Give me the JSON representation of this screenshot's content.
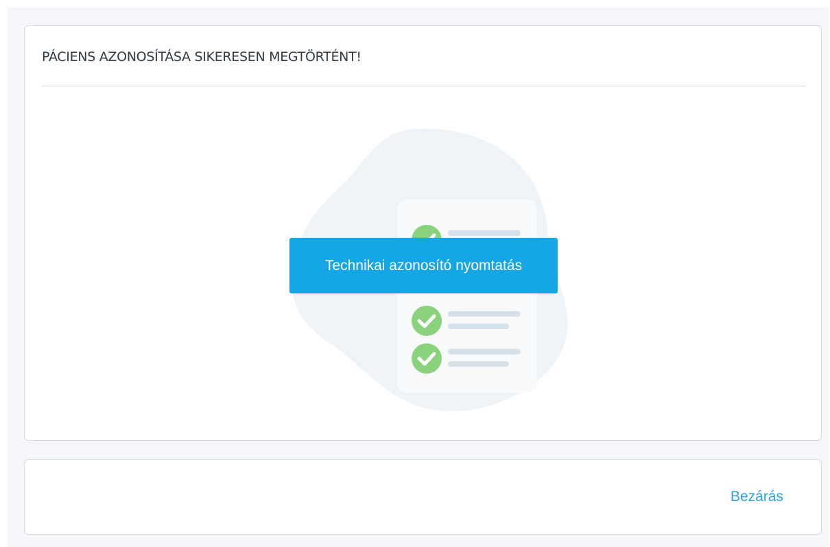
{
  "dialog": {
    "title": "PÁCIENS AZONOSÍTÁSA SIKERESEN MEGTÖRTÉNT!",
    "print_button_label": "Technikai azonosító nyomtatás",
    "illustration_icon": "checklist-document-icon",
    "check_icon": "check-circle-icon"
  },
  "footer": {
    "close_label": "Bezárás"
  },
  "colors": {
    "accent": "#15a6e6",
    "link": "#2b9fdb",
    "check": "#8bd27c",
    "blob": "#eef3f7"
  }
}
